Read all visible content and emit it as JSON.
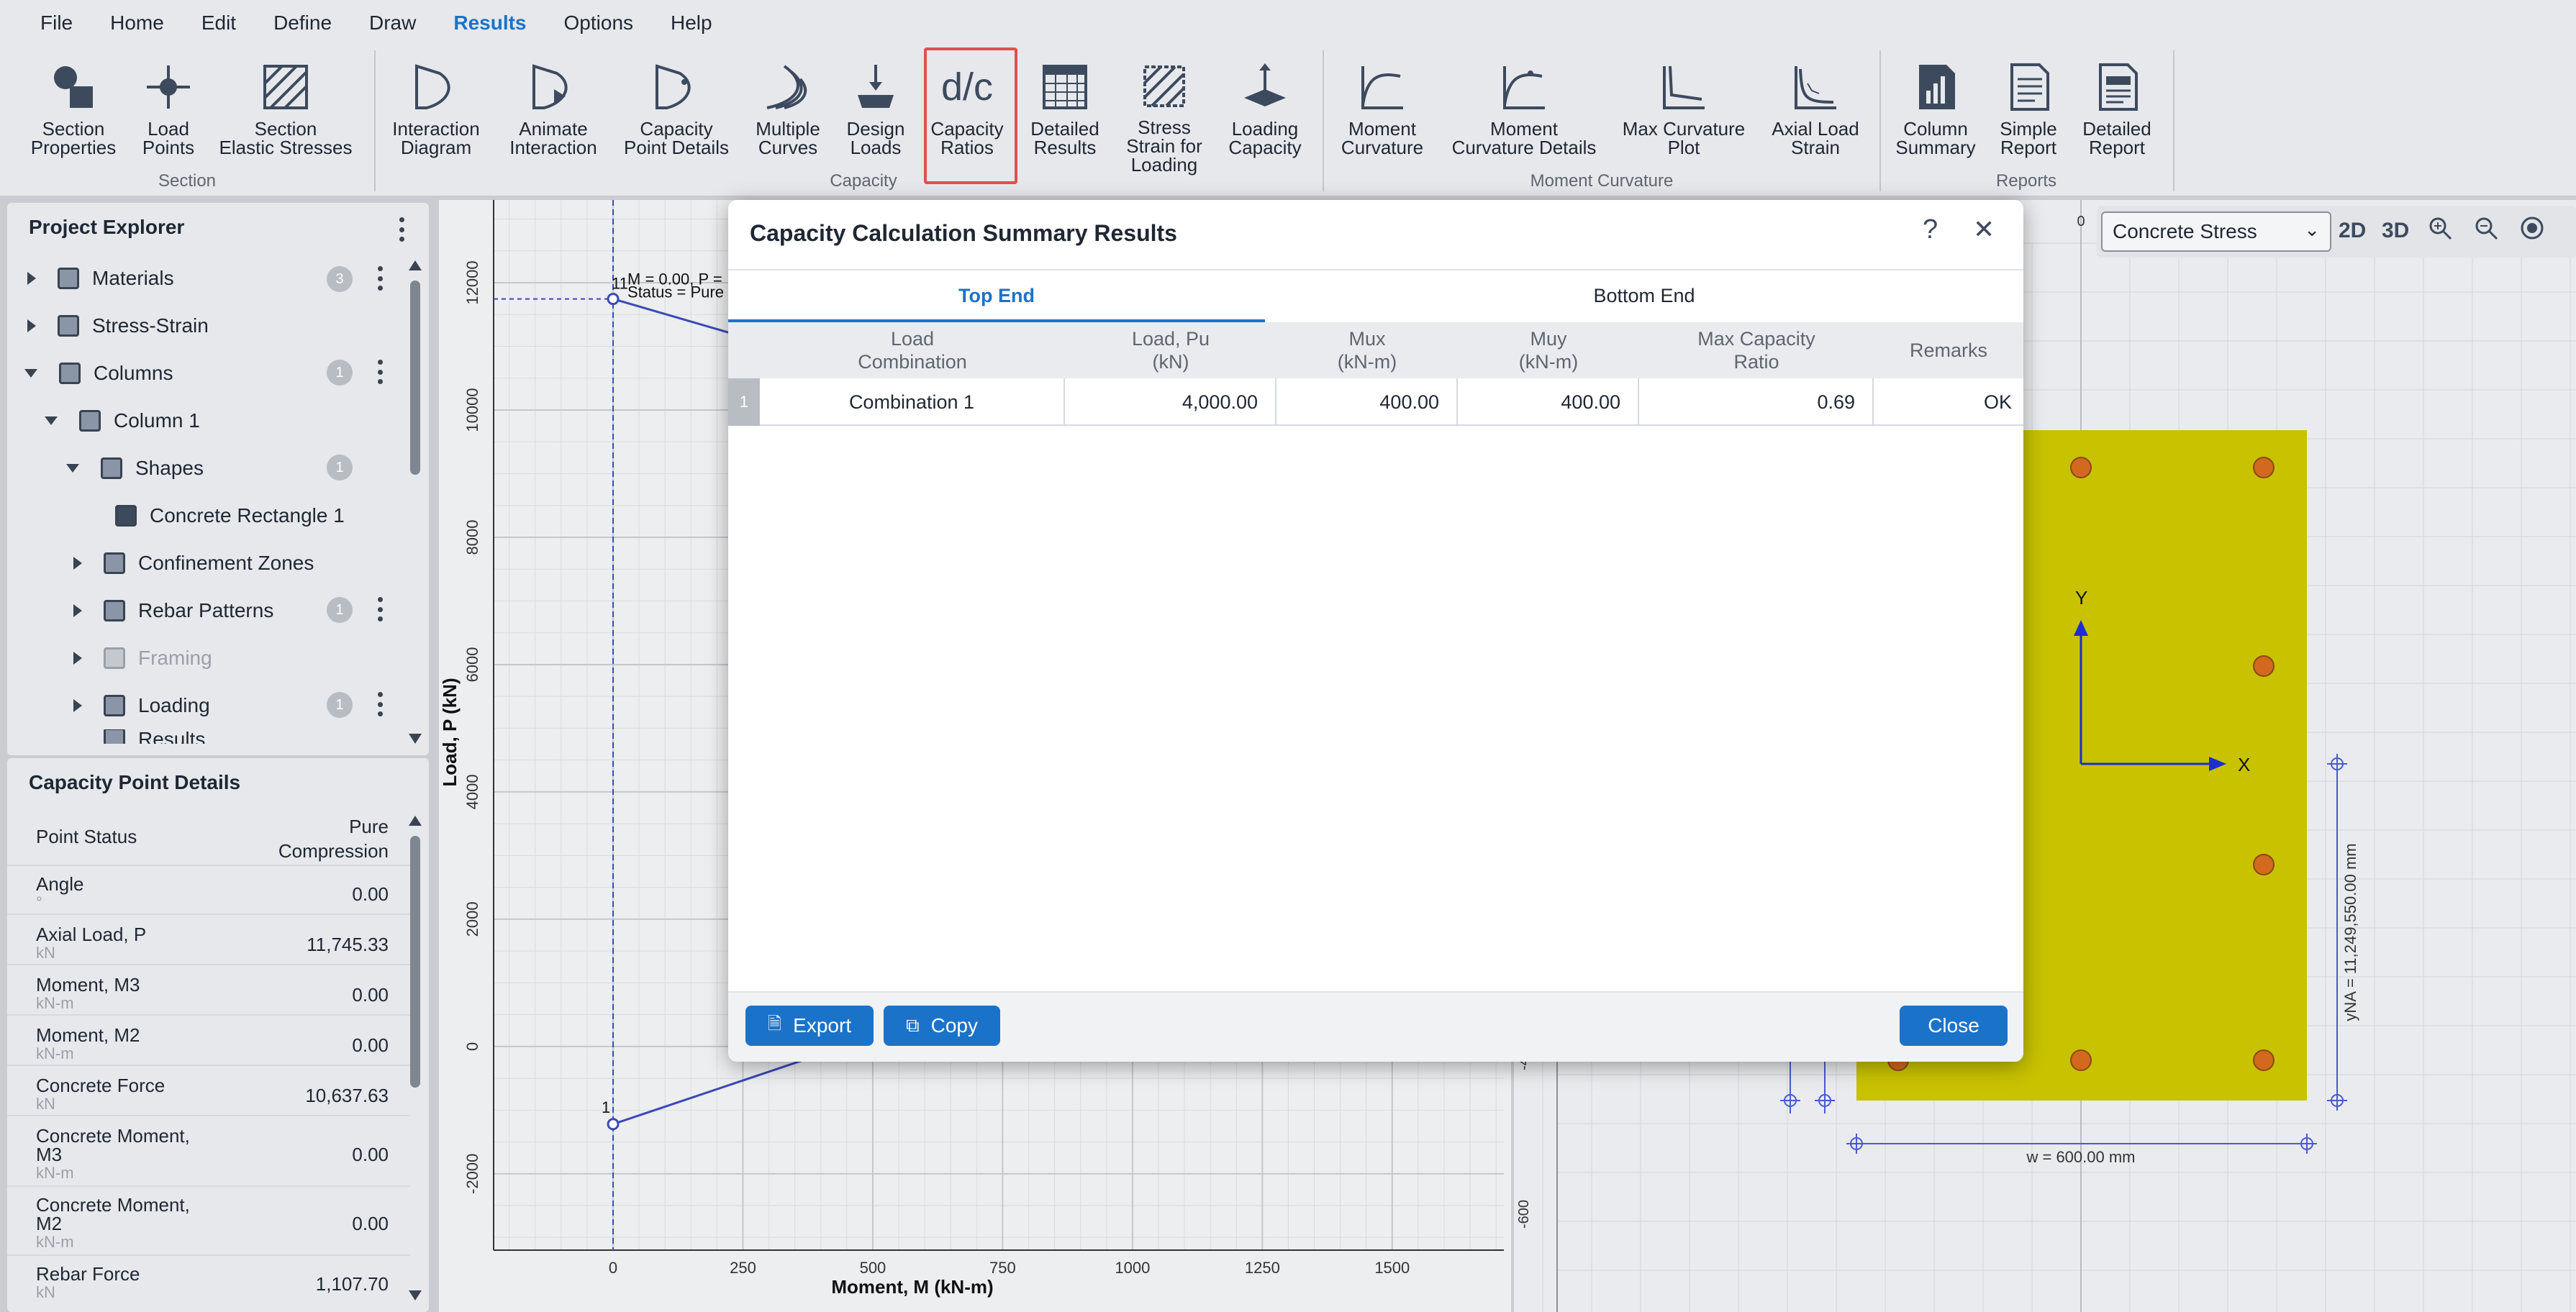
{
  "menu": [
    "File",
    "Home",
    "Edit",
    "Define",
    "Draw",
    "Results",
    "Options",
    "Help"
  ],
  "ribbon": {
    "section_group": "Section",
    "capacity_group": "Capacity",
    "moment_group": "Moment Curvature",
    "reports_group": "Reports",
    "buttons": {
      "section_properties": "Section\nProperties",
      "load_points": "Load\nPoints",
      "section_elastic": "Section\nElastic Stresses",
      "interaction_diagram": "Interaction\nDiagram",
      "animate_interaction": "Animate\nInteraction",
      "capacity_point_details": "Capacity\nPoint Details",
      "multiple_curves": "Multiple\nCurves",
      "design_loads": "Design\nLoads",
      "capacity_ratios": "Capacity\nRatios",
      "detailed_results": "Detailed\nResults",
      "stress_strain_loading": "Stress\nStrain for\nLoading",
      "loading_capacity": "Loading\nCapacity",
      "moment_curvature": "Moment\nCurvature",
      "moment_curvature_details": "Moment\nCurvature Details",
      "max_curvature_plot": "Max Curvature\nPlot",
      "axial_load_strain": "Axial Load\nStrain",
      "column_summary": "Column\nSummary",
      "simple_report": "Simple\nReport",
      "detailed_report": "Detailed\nReport"
    },
    "dc_glyph": "d/c"
  },
  "project_explorer": {
    "title": "Project Explorer",
    "items": [
      {
        "label": "Materials",
        "badge": "3"
      },
      {
        "label": "Stress-Strain",
        "badge": ""
      },
      {
        "label": "Columns",
        "badge": "1"
      },
      {
        "label": "Column 1",
        "badge": ""
      },
      {
        "label": "Shapes",
        "badge": "1"
      },
      {
        "label": "Concrete Rectangle 1",
        "badge": ""
      },
      {
        "label": "Confinement Zones",
        "badge": ""
      },
      {
        "label": "Rebar Patterns",
        "badge": "1"
      },
      {
        "label": "Framing",
        "badge": ""
      },
      {
        "label": "Loading",
        "badge": "1"
      },
      {
        "label": "Results",
        "badge": ""
      }
    ]
  },
  "capacity_point": {
    "title": "Capacity Point Details",
    "rows": [
      {
        "name": "Point Status",
        "unit": "",
        "value": "Pure\nCompression"
      },
      {
        "name": "Angle",
        "unit": "°",
        "value": "0.00"
      },
      {
        "name": "Axial Load, P",
        "unit": "kN",
        "value": "11,745.33"
      },
      {
        "name": "Moment, M3",
        "unit": "kN-m",
        "value": "0.00"
      },
      {
        "name": "Moment, M2",
        "unit": "kN-m",
        "value": "0.00"
      },
      {
        "name": "Concrete Force",
        "unit": "kN",
        "value": "10,637.63"
      },
      {
        "name": "Concrete Moment,\nM3",
        "unit": "kN-m",
        "value": "0.00"
      },
      {
        "name": "Concrete Moment,\nM2",
        "unit": "kN-m",
        "value": "0.00"
      },
      {
        "name": "Rebar Force",
        "unit": "kN",
        "value": "1,107.70"
      }
    ]
  },
  "chart_data": {
    "type": "line",
    "xlabel": "Moment, M (kN-m)",
    "ylabel": "Load, P (kN)",
    "x_ticks": [
      0,
      250,
      500,
      750,
      1000,
      1250,
      1500
    ],
    "y_ticks": [
      -2000,
      0,
      2000,
      4000,
      6000,
      8000,
      10000,
      12000
    ],
    "xlim": [
      -230,
      1715
    ],
    "ylim": [
      -3200,
      13300
    ],
    "point_labels": [
      "11",
      "1"
    ],
    "annotation_line1": "M = 0.00, P =",
    "annotation_line2": "Status = Pure",
    "series": [
      {
        "x": [
          0,
          230
        ],
        "y": [
          11745,
          11200
        ]
      },
      {
        "x": [
          0,
          430
        ],
        "y": [
          -1220,
          -40
        ]
      }
    ],
    "point_11": {
      "x": 0,
      "y": 11745
    },
    "point_1": {
      "x": 0,
      "y": -1220
    }
  },
  "section_view": {
    "dropdown_value": "Concrete Stress",
    "btn_2d": "2D",
    "btn_3d": "3D",
    "axis_y": "Y",
    "axis_x": "X",
    "dim_w": "w = 600.00 mm",
    "dim_yna": "yNA = 11,249,550.00 mm",
    "ruler_top": "0",
    "ruler_left_1": "-4",
    "ruler_left_2": "-600",
    "section_color": "#c8c200",
    "rebar_color": "#d2691e"
  },
  "modal": {
    "title": "Capacity Calculation Summary Results",
    "help": "?",
    "close_x": "✕",
    "tabs": [
      "Top End",
      "Bottom End"
    ],
    "columns": [
      "Load\nCombination",
      "Load, Pu\n(kN)",
      "Mux\n(kN-m)",
      "Muy\n(kN-m)",
      "Max Capacity\nRatio",
      "Remarks"
    ],
    "rows": [
      {
        "index": "1",
        "combo": "Combination 1",
        "pu": "4,000.00",
        "mux": "400.00",
        "muy": "400.00",
        "ratio": "0.69",
        "remarks": "OK"
      }
    ],
    "export_label": "Export",
    "copy_label": "Copy",
    "close_label": "Close",
    "accent": "#1a73c9"
  }
}
